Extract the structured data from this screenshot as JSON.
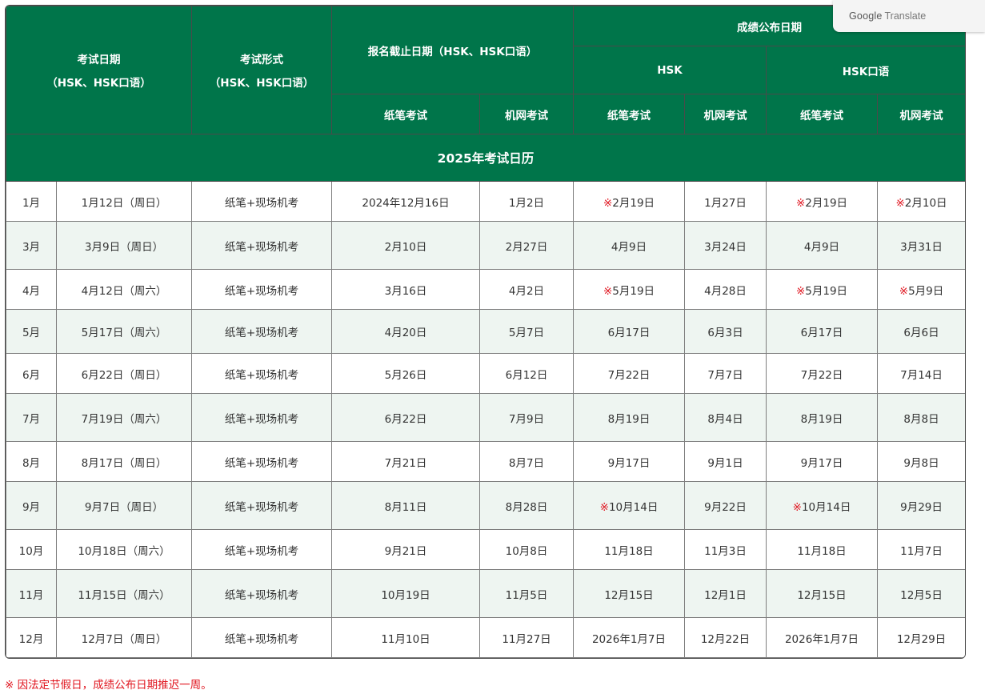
{
  "translate_widget": {
    "brand": "Google",
    "label": "Translate"
  },
  "header": {
    "exam_date": "考试日期",
    "exam_date_sub": "（HSK、HSK口语）",
    "exam_form": "考试形式",
    "exam_form_sub": "（HSK、HSK口语）",
    "reg_deadline": "报名截止日期（HSK、HSK口语）",
    "results_date": "成绩公布日期",
    "hsk": "HSK",
    "hsk_oral": "HSK口语",
    "paper": "纸笔考试",
    "online": "机网考试"
  },
  "banner": "2025年考试日历",
  "mark": "※",
  "rows": [
    {
      "month": "1月",
      "date": "1月12日（周日）",
      "form": "纸笔+现场机考",
      "reg_paper": "2024年12月16日",
      "reg_online": "1月2日",
      "hsk_paper": "2月19日",
      "hsk_paper_mark": true,
      "hsk_online": "1月27日",
      "hsk_online_mark": false,
      "oral_paper": "2月19日",
      "oral_paper_mark": true,
      "oral_online": "2月10日",
      "oral_online_mark": true
    },
    {
      "month": "3月",
      "date": "3月9日（周日）",
      "form": "纸笔+现场机考",
      "reg_paper": "2月10日",
      "reg_online": "2月27日",
      "hsk_paper": "4月9日",
      "hsk_paper_mark": false,
      "hsk_online": "3月24日",
      "hsk_online_mark": false,
      "oral_paper": "4月9日",
      "oral_paper_mark": false,
      "oral_online": "3月31日",
      "oral_online_mark": false
    },
    {
      "month": "4月",
      "date": "4月12日（周六）",
      "form": "纸笔+现场机考",
      "reg_paper": "3月16日",
      "reg_online": "4月2日",
      "hsk_paper": "5月19日",
      "hsk_paper_mark": true,
      "hsk_online": "4月28日",
      "hsk_online_mark": false,
      "oral_paper": "5月19日",
      "oral_paper_mark": true,
      "oral_online": "5月9日",
      "oral_online_mark": true
    },
    {
      "month": "5月",
      "date": "5月17日（周六）",
      "form": "纸笔+现场机考",
      "reg_paper": "4月20日",
      "reg_online": "5月7日",
      "hsk_paper": "6月17日",
      "hsk_paper_mark": false,
      "hsk_online": "6月3日",
      "hsk_online_mark": false,
      "oral_paper": "6月17日",
      "oral_paper_mark": false,
      "oral_online": "6月6日",
      "oral_online_mark": false
    },
    {
      "month": "6月",
      "date": "6月22日（周日）",
      "form": "纸笔+现场机考",
      "reg_paper": "5月26日",
      "reg_online": "6月12日",
      "hsk_paper": "7月22日",
      "hsk_paper_mark": false,
      "hsk_online": "7月7日",
      "hsk_online_mark": false,
      "oral_paper": "7月22日",
      "oral_paper_mark": false,
      "oral_online": "7月14日",
      "oral_online_mark": false
    },
    {
      "month": "7月",
      "date": "7月19日（周六）",
      "form": "纸笔+现场机考",
      "reg_paper": "6月22日",
      "reg_online": "7月9日",
      "hsk_paper": "8月19日",
      "hsk_paper_mark": false,
      "hsk_online": "8月4日",
      "hsk_online_mark": false,
      "oral_paper": "8月19日",
      "oral_paper_mark": false,
      "oral_online": "8月8日",
      "oral_online_mark": false
    },
    {
      "month": "8月",
      "date": "8月17日（周日）",
      "form": "纸笔+现场机考",
      "reg_paper": "7月21日",
      "reg_online": "8月7日",
      "hsk_paper": "9月17日",
      "hsk_paper_mark": false,
      "hsk_online": "9月1日",
      "hsk_online_mark": false,
      "oral_paper": "9月17日",
      "oral_paper_mark": false,
      "oral_online": "9月8日",
      "oral_online_mark": false
    },
    {
      "month": "9月",
      "date": "9月7日（周日）",
      "form": "纸笔+现场机考",
      "reg_paper": "8月11日",
      "reg_online": "8月28日",
      "hsk_paper": "10月14日",
      "hsk_paper_mark": true,
      "hsk_online": "9月22日",
      "hsk_online_mark": false,
      "oral_paper": "10月14日",
      "oral_paper_mark": true,
      "oral_online": "9月29日",
      "oral_online_mark": false
    },
    {
      "month": "10月",
      "date": "10月18日（周六）",
      "form": "纸笔+现场机考",
      "reg_paper": "9月21日",
      "reg_online": "10月8日",
      "hsk_paper": "11月18日",
      "hsk_paper_mark": false,
      "hsk_online": "11月3日",
      "hsk_online_mark": false,
      "oral_paper": "11月18日",
      "oral_paper_mark": false,
      "oral_online": "11月7日",
      "oral_online_mark": false
    },
    {
      "month": "11月",
      "date": "11月15日（周六）",
      "form": "纸笔+现场机考",
      "reg_paper": "10月19日",
      "reg_online": "11月5日",
      "hsk_paper": "12月15日",
      "hsk_paper_mark": false,
      "hsk_online": "12月1日",
      "hsk_online_mark": false,
      "oral_paper": "12月15日",
      "oral_paper_mark": false,
      "oral_online": "12月5日",
      "oral_online_mark": false
    },
    {
      "month": "12月",
      "date": "12月7日（周日）",
      "form": "纸笔+现场机考",
      "reg_paper": "11月10日",
      "reg_online": "11月27日",
      "hsk_paper": "2026年1月7日",
      "hsk_paper_mark": false,
      "hsk_online": "12月22日",
      "hsk_online_mark": false,
      "oral_paper": "2026年1月7日",
      "oral_paper_mark": false,
      "oral_online": "12月29日",
      "oral_online_mark": false
    }
  ],
  "footnote": "※ 因法定节假日，成绩公布日期推迟一周。",
  "colors": {
    "header_bg": "#00754a",
    "alt_row": "#eef5f1",
    "mark": "#e0141e"
  }
}
